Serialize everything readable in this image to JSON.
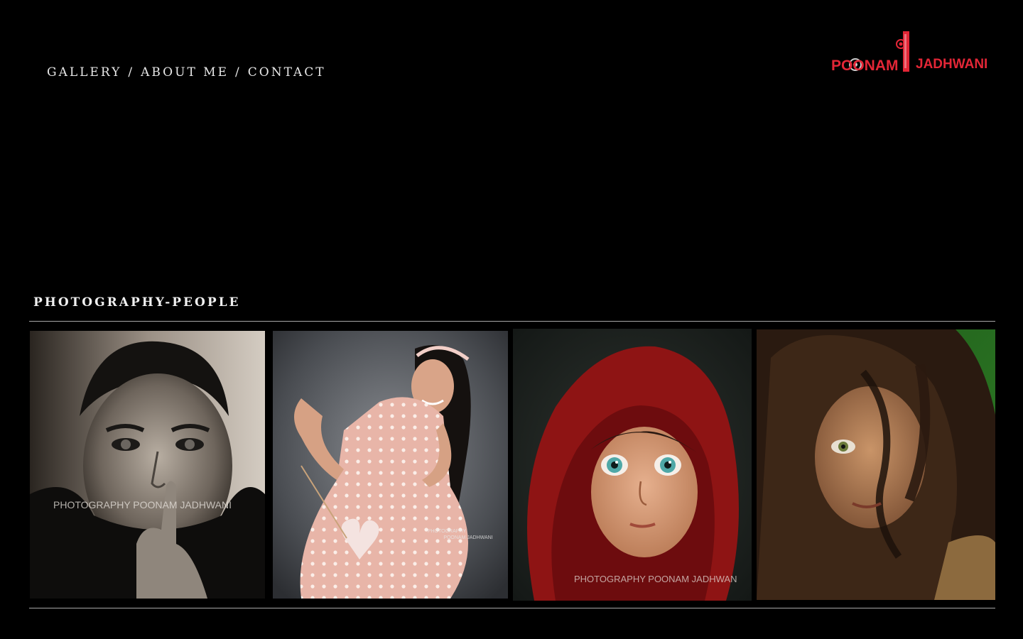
{
  "nav": {
    "gallery": "GALLERY",
    "about": "ABOUT ME",
    "contact": "CONTACT",
    "separator": "/"
  },
  "logo": {
    "text_left": "POONAM",
    "text_right": "JADHWANI",
    "color": "#e32636"
  },
  "section": {
    "title": "PHOTOGRAPHY-PEOPLE"
  },
  "gallery": {
    "items": [
      {
        "watermark": "PHOTOGRAPHY POONAM JADHWANI"
      },
      {
        "watermark_line1": "PHOTOGRAPHY",
        "watermark_line2": "POONAM JADHWANI"
      },
      {
        "watermark": "PHOTOGRAPHY POONAM JADHWAN"
      },
      {
        "watermark": ""
      }
    ]
  }
}
